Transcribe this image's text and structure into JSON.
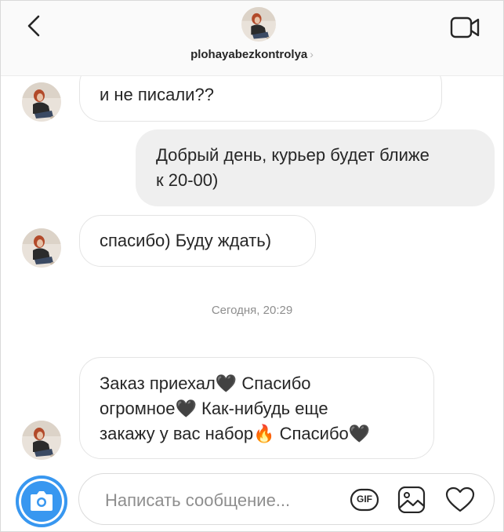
{
  "header": {
    "username": "plohayabezkontrolya",
    "chevron": "›"
  },
  "messages": [
    {
      "direction": "incoming",
      "partial_top": "?",
      "text": "и не писали??"
    },
    {
      "direction": "outgoing",
      "line1": "Добрый день, курьер будет ближе",
      "line2": "к 20-00)"
    },
    {
      "direction": "incoming",
      "text": "спасибо) Буду ждать)"
    },
    {
      "direction": "incoming",
      "l1a": "Заказ приехал",
      "l1b": " Спасибо",
      "l2a": "огромное",
      "l2b": " Как-нибудь еще",
      "l3a": "закажу у вас набор",
      "l3b": " Спасибо",
      "heart": "🖤",
      "fire": "🔥"
    }
  ],
  "timestamp": "Сегодня, 20:29",
  "composer": {
    "placeholder": "Написать сообщение...",
    "gif_label": "GIF"
  },
  "icons": {
    "back": "chevron-left-icon",
    "video": "video-camera-icon",
    "camera": "camera-icon",
    "gif": "gif-icon",
    "image": "image-icon",
    "heart": "heart-icon"
  },
  "colors": {
    "accent": "#3897f0",
    "outgoing_bubble": "#efefef",
    "incoming_border": "#e4e4e4",
    "timestamp": "#8e8e8e"
  }
}
